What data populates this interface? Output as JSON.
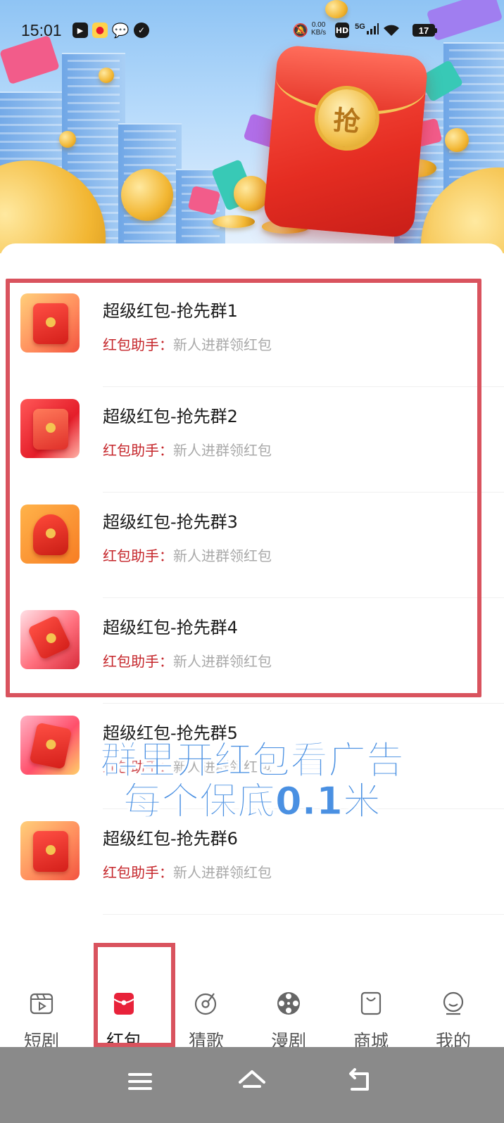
{
  "status_bar": {
    "time": "15:01",
    "net_speed_value": "0.00",
    "net_speed_unit": "KB/s",
    "hd_label": "HD",
    "signal_label": "5G",
    "battery_level": "17"
  },
  "banner": {
    "seal_char": "抢"
  },
  "groups": [
    {
      "title": "超级红包-抢先群1",
      "sender": "红包助手：",
      "message": "新人进群领红包"
    },
    {
      "title": "超级红包-抢先群2",
      "sender": "红包助手：",
      "message": "新人进群领红包"
    },
    {
      "title": "超级红包-抢先群3",
      "sender": "红包助手：",
      "message": "新人进群领红包"
    },
    {
      "title": "超级红包-抢先群4",
      "sender": "红包助手：",
      "message": "新人进群领红包"
    },
    {
      "title": "超级红包-抢先群5",
      "sender": "红包助手：",
      "message": "新人进群领红包"
    },
    {
      "title": "超级红包-抢先群6",
      "sender": "红包助手：",
      "message": "新人进群领红包"
    }
  ],
  "overlay": {
    "line1": "群里开红包看广告",
    "line2": "每个保底0.1米"
  },
  "bottom_nav": {
    "items": [
      {
        "label": "短剧",
        "icon": "short-drama-icon"
      },
      {
        "label": "红包",
        "icon": "red-packet-icon",
        "active": true
      },
      {
        "label": "猜歌",
        "icon": "music-disc-icon"
      },
      {
        "label": "漫剧",
        "icon": "film-reel-icon"
      },
      {
        "label": "商城",
        "icon": "shopping-bag-icon"
      },
      {
        "label": "我的",
        "icon": "profile-icon"
      }
    ]
  },
  "colors": {
    "accent_red": "#c5262b",
    "highlight_border": "#d9535e",
    "overlay_text": "#4a90e2",
    "secondary_text": "#a9a9a9"
  }
}
